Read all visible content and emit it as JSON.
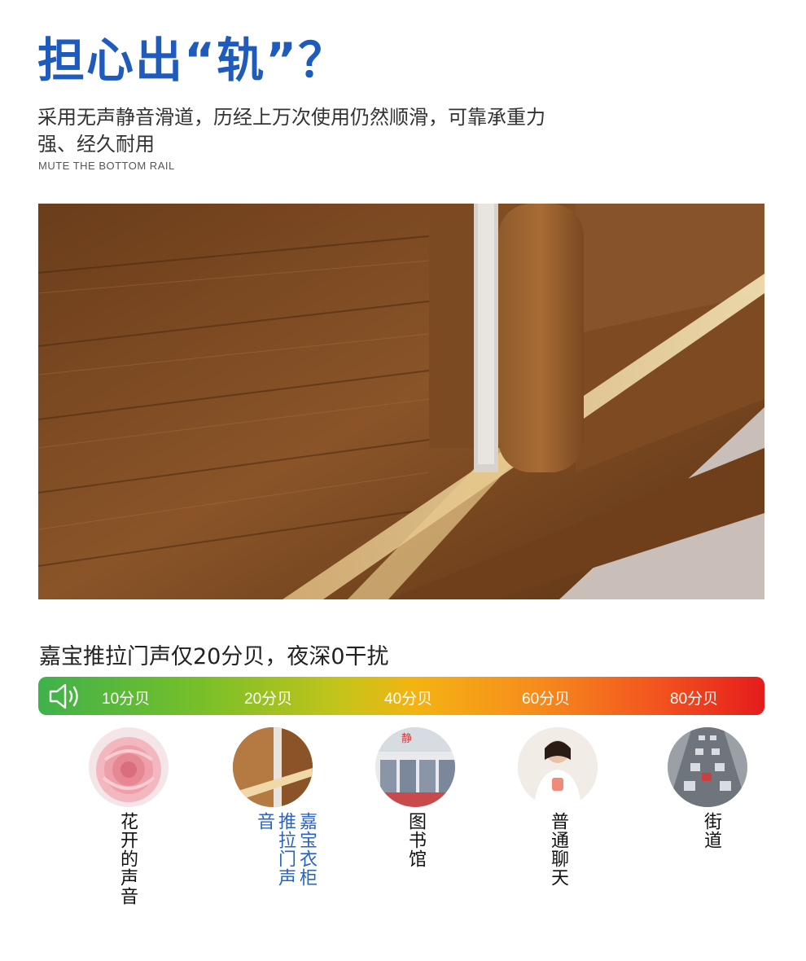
{
  "headline": "担心出“轨”？",
  "description": "采用无声静音滑道，历经上万次使用仍然顺滑，可靠承重力强、经久耐用",
  "description_en": "MUTE THE BOTTOM RAIL",
  "photo_icon": "sliding-door-rail-photo",
  "claim": "嘉宝推拉门声仅20分贝，夜深0干扰",
  "scale": {
    "icon": "speaker-icon",
    "colors": {
      "start": "#3fb24a",
      "middle": "#f4b312",
      "end": "#e51c1c"
    },
    "ticks": [
      "10分贝",
      "20分贝",
      "40分贝",
      "60分贝",
      "80分贝"
    ]
  },
  "sources": [
    {
      "icon": "rose-icon",
      "label": "花开的声音"
    },
    {
      "icon": "wardrobe-icon",
      "label": "嘉宝衣柜推拉门声音"
    },
    {
      "icon": "library-icon",
      "label": "图书馆"
    },
    {
      "icon": "chatting-woman-icon",
      "label": "普通聊天"
    },
    {
      "icon": "street-traffic-icon",
      "label": "街道"
    }
  ],
  "highlight_color": "#2a63c4",
  "brand_color": "#1f5bbd"
}
